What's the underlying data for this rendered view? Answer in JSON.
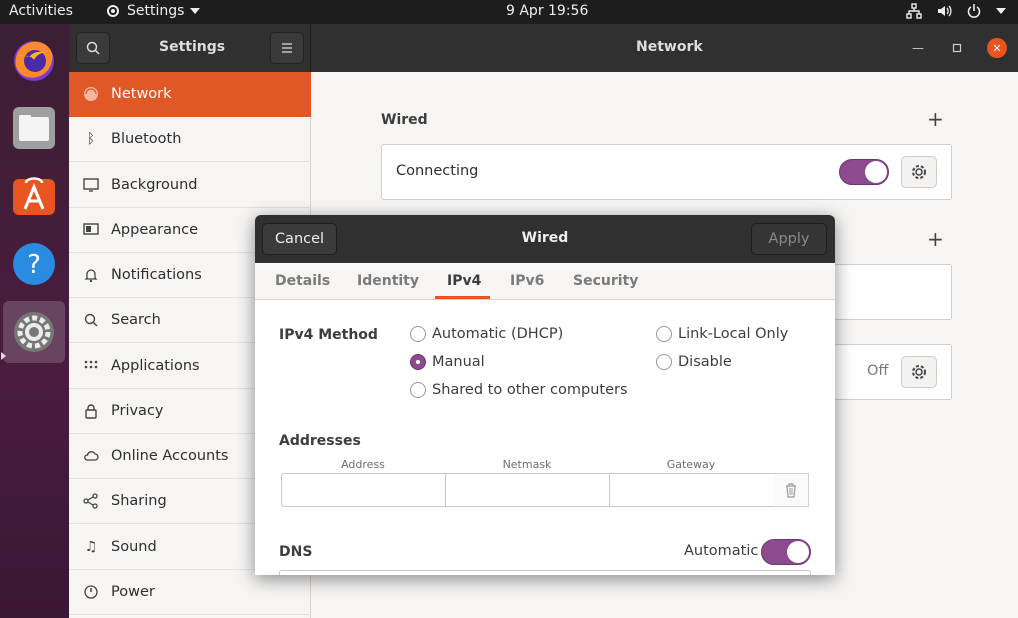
{
  "topbar": {
    "activities": "Activities",
    "app_menu": "Settings",
    "clock": "9 Apr  19:56"
  },
  "dock": {
    "items": [
      "Firefox",
      "Files",
      "Ubuntu Software",
      "Help",
      "Settings"
    ]
  },
  "window": {
    "sidebar_title": "Settings",
    "panel_title": "Network"
  },
  "sidebar": {
    "items": [
      {
        "label": "Network",
        "icon": "network-icon"
      },
      {
        "label": "Bluetooth",
        "icon": "bluetooth-icon"
      },
      {
        "label": "Background",
        "icon": "background-icon"
      },
      {
        "label": "Appearance",
        "icon": "appearance-icon"
      },
      {
        "label": "Notifications",
        "icon": "bell-icon"
      },
      {
        "label": "Search",
        "icon": "search-icon"
      },
      {
        "label": "Applications",
        "icon": "grid-icon"
      },
      {
        "label": "Privacy",
        "icon": "lock-icon"
      },
      {
        "label": "Online Accounts",
        "icon": "cloud-icon"
      },
      {
        "label": "Sharing",
        "icon": "share-icon"
      },
      {
        "label": "Sound",
        "icon": "music-note-icon"
      },
      {
        "label": "Power",
        "icon": "power-icon"
      }
    ]
  },
  "network": {
    "wired_title": "Wired",
    "wired_status": "Connecting",
    "vpn_status": "Off"
  },
  "dialog": {
    "cancel": "Cancel",
    "title": "Wired",
    "apply": "Apply",
    "tabs": [
      "Details",
      "Identity",
      "IPv4",
      "IPv6",
      "Security"
    ],
    "active_tab": "IPv4",
    "method_label": "IPv4 Method",
    "methods": {
      "automatic": "Automatic (DHCP)",
      "manual": "Manual",
      "shared": "Shared to other computers",
      "link_local": "Link-Local Only",
      "disable": "Disable"
    },
    "selected_method": "Manual",
    "addresses_label": "Addresses",
    "columns": {
      "address": "Address",
      "netmask": "Netmask",
      "gateway": "Gateway"
    },
    "address_value": "",
    "netmask_value": "",
    "gateway_value": "",
    "dns_label": "DNS",
    "dns_auto_label": "Automatic",
    "dns_auto": true
  },
  "colors": {
    "accent": "#e95420",
    "toggle_on": "#8c4a8f",
    "headerbar": "#303030"
  }
}
